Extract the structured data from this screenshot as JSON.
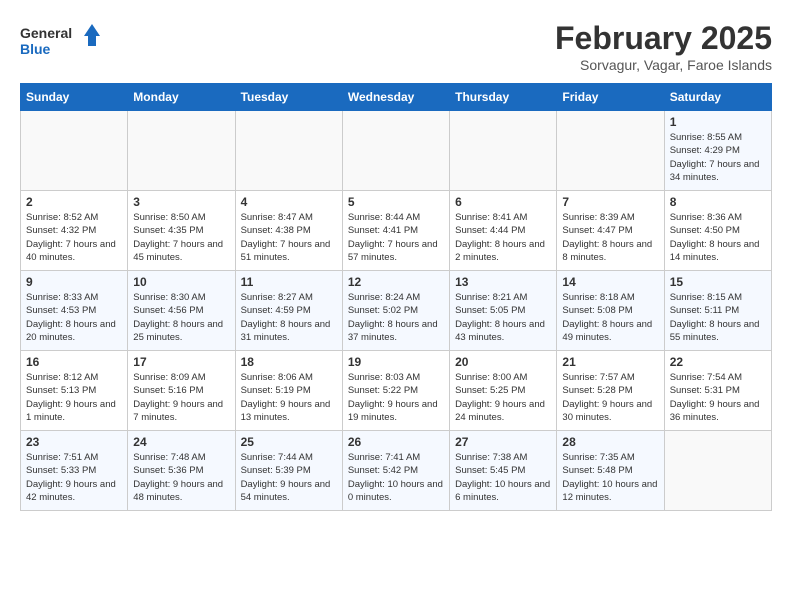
{
  "header": {
    "logo_line1": "General",
    "logo_line2": "Blue",
    "month": "February 2025",
    "location": "Sorvagur, Vagar, Faroe Islands"
  },
  "weekdays": [
    "Sunday",
    "Monday",
    "Tuesday",
    "Wednesday",
    "Thursday",
    "Friday",
    "Saturday"
  ],
  "weeks": [
    [
      {
        "day": "",
        "info": ""
      },
      {
        "day": "",
        "info": ""
      },
      {
        "day": "",
        "info": ""
      },
      {
        "day": "",
        "info": ""
      },
      {
        "day": "",
        "info": ""
      },
      {
        "day": "",
        "info": ""
      },
      {
        "day": "1",
        "info": "Sunrise: 8:55 AM\nSunset: 4:29 PM\nDaylight: 7 hours and 34 minutes."
      }
    ],
    [
      {
        "day": "2",
        "info": "Sunrise: 8:52 AM\nSunset: 4:32 PM\nDaylight: 7 hours and 40 minutes."
      },
      {
        "day": "3",
        "info": "Sunrise: 8:50 AM\nSunset: 4:35 PM\nDaylight: 7 hours and 45 minutes."
      },
      {
        "day": "4",
        "info": "Sunrise: 8:47 AM\nSunset: 4:38 PM\nDaylight: 7 hours and 51 minutes."
      },
      {
        "day": "5",
        "info": "Sunrise: 8:44 AM\nSunset: 4:41 PM\nDaylight: 7 hours and 57 minutes."
      },
      {
        "day": "6",
        "info": "Sunrise: 8:41 AM\nSunset: 4:44 PM\nDaylight: 8 hours and 2 minutes."
      },
      {
        "day": "7",
        "info": "Sunrise: 8:39 AM\nSunset: 4:47 PM\nDaylight: 8 hours and 8 minutes."
      },
      {
        "day": "8",
        "info": "Sunrise: 8:36 AM\nSunset: 4:50 PM\nDaylight: 8 hours and 14 minutes."
      }
    ],
    [
      {
        "day": "9",
        "info": "Sunrise: 8:33 AM\nSunset: 4:53 PM\nDaylight: 8 hours and 20 minutes."
      },
      {
        "day": "10",
        "info": "Sunrise: 8:30 AM\nSunset: 4:56 PM\nDaylight: 8 hours and 25 minutes."
      },
      {
        "day": "11",
        "info": "Sunrise: 8:27 AM\nSunset: 4:59 PM\nDaylight: 8 hours and 31 minutes."
      },
      {
        "day": "12",
        "info": "Sunrise: 8:24 AM\nSunset: 5:02 PM\nDaylight: 8 hours and 37 minutes."
      },
      {
        "day": "13",
        "info": "Sunrise: 8:21 AM\nSunset: 5:05 PM\nDaylight: 8 hours and 43 minutes."
      },
      {
        "day": "14",
        "info": "Sunrise: 8:18 AM\nSunset: 5:08 PM\nDaylight: 8 hours and 49 minutes."
      },
      {
        "day": "15",
        "info": "Sunrise: 8:15 AM\nSunset: 5:11 PM\nDaylight: 8 hours and 55 minutes."
      }
    ],
    [
      {
        "day": "16",
        "info": "Sunrise: 8:12 AM\nSunset: 5:13 PM\nDaylight: 9 hours and 1 minute."
      },
      {
        "day": "17",
        "info": "Sunrise: 8:09 AM\nSunset: 5:16 PM\nDaylight: 9 hours and 7 minutes."
      },
      {
        "day": "18",
        "info": "Sunrise: 8:06 AM\nSunset: 5:19 PM\nDaylight: 9 hours and 13 minutes."
      },
      {
        "day": "19",
        "info": "Sunrise: 8:03 AM\nSunset: 5:22 PM\nDaylight: 9 hours and 19 minutes."
      },
      {
        "day": "20",
        "info": "Sunrise: 8:00 AM\nSunset: 5:25 PM\nDaylight: 9 hours and 24 minutes."
      },
      {
        "day": "21",
        "info": "Sunrise: 7:57 AM\nSunset: 5:28 PM\nDaylight: 9 hours and 30 minutes."
      },
      {
        "day": "22",
        "info": "Sunrise: 7:54 AM\nSunset: 5:31 PM\nDaylight: 9 hours and 36 minutes."
      }
    ],
    [
      {
        "day": "23",
        "info": "Sunrise: 7:51 AM\nSunset: 5:33 PM\nDaylight: 9 hours and 42 minutes."
      },
      {
        "day": "24",
        "info": "Sunrise: 7:48 AM\nSunset: 5:36 PM\nDaylight: 9 hours and 48 minutes."
      },
      {
        "day": "25",
        "info": "Sunrise: 7:44 AM\nSunset: 5:39 PM\nDaylight: 9 hours and 54 minutes."
      },
      {
        "day": "26",
        "info": "Sunrise: 7:41 AM\nSunset: 5:42 PM\nDaylight: 10 hours and 0 minutes."
      },
      {
        "day": "27",
        "info": "Sunrise: 7:38 AM\nSunset: 5:45 PM\nDaylight: 10 hours and 6 minutes."
      },
      {
        "day": "28",
        "info": "Sunrise: 7:35 AM\nSunset: 5:48 PM\nDaylight: 10 hours and 12 minutes."
      },
      {
        "day": "",
        "info": ""
      }
    ]
  ]
}
